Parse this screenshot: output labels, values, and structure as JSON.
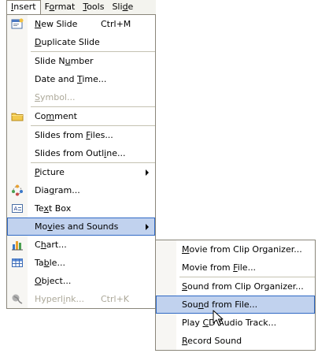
{
  "menubar": {
    "items": [
      {
        "pre": "",
        "u": "I",
        "post": "nsert"
      },
      {
        "pre": "F",
        "u": "o",
        "post": "rmat"
      },
      {
        "pre": "",
        "u": "T",
        "post": "ools"
      },
      {
        "pre": "Sli",
        "u": "d",
        "post": "e"
      }
    ]
  },
  "insert_menu": {
    "items": [
      {
        "pre": "",
        "u": "N",
        "post": "ew Slide",
        "shortcut": "Ctrl+M",
        "icon": "new-slide-icon"
      },
      {
        "pre": "",
        "u": "D",
        "post": "uplicate Slide"
      },
      {
        "pre": "Slide N",
        "u": "u",
        "post": "mber"
      },
      {
        "pre": "Date and ",
        "u": "T",
        "post": "ime..."
      },
      {
        "pre": "",
        "u": "S",
        "post": "ymbol...",
        "disabled": true
      },
      {
        "pre": "Co",
        "u": "m",
        "post": "ment",
        "icon": "comment-folder-icon"
      },
      {
        "pre": "Slides from ",
        "u": "F",
        "post": "iles..."
      },
      {
        "pre": "Slides from Outl",
        "u": "i",
        "post": "ne..."
      },
      {
        "pre": "",
        "u": "P",
        "post": "icture"
      },
      {
        "pre": "Dia",
        "u": "g",
        "post": "ram...",
        "icon": "diagram-icon"
      },
      {
        "pre": "Te",
        "u": "x",
        "post": "t Box",
        "icon": "text-box-icon"
      },
      {
        "pre": "Mo",
        "u": "v",
        "post": "ies and Sounds"
      },
      {
        "pre": "C",
        "u": "h",
        "post": "art...",
        "icon": "chart-icon"
      },
      {
        "pre": "Ta",
        "u": "b",
        "post": "le...",
        "icon": "table-icon"
      },
      {
        "pre": "",
        "u": "O",
        "post": "bject..."
      },
      {
        "pre": "Hyperl",
        "u": "i",
        "post": "nk...",
        "shortcut": "Ctrl+K",
        "disabled": true,
        "icon": "hyperlink-icon"
      }
    ]
  },
  "movies_sounds_submenu": {
    "items": [
      {
        "pre": "",
        "u": "M",
        "post": "ovie from Clip Organizer..."
      },
      {
        "pre": "Movie from ",
        "u": "F",
        "post": "ile..."
      },
      {
        "pre": "",
        "u": "S",
        "post": "ound from Clip Organizer..."
      },
      {
        "pre": "Sou",
        "u": "n",
        "post": "d from File..."
      },
      {
        "pre": "Play ",
        "u": "C",
        "post": "D Audio Track..."
      },
      {
        "pre": "",
        "u": "R",
        "post": "ecord Sound"
      }
    ]
  },
  "colors": {
    "highlight_fill": "#c1d2ee",
    "highlight_border": "#316ac5",
    "disabled_text": "#aca899",
    "menubar_bg": "#f3f3ee"
  }
}
